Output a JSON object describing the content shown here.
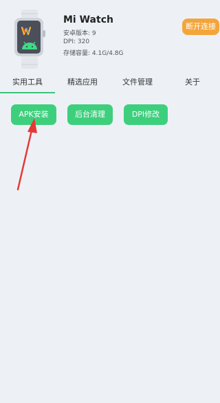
{
  "device": {
    "name": "Mi Watch",
    "version": "安卓版本: 9",
    "dpi": "DPI: 320",
    "storage": "存储容量: 4.1G/4.8G",
    "disconnect_label": "断开连接"
  },
  "tabs": [
    {
      "label": "实用工具",
      "active": true
    },
    {
      "label": "精选应用",
      "active": false
    },
    {
      "label": "文件管理",
      "active": false
    },
    {
      "label": "关于",
      "active": false
    }
  ],
  "tools": [
    {
      "label": "APK安装"
    },
    {
      "label": "后台清理"
    },
    {
      "label": "DPI修改"
    }
  ],
  "colors": {
    "background": "#edf1f6",
    "accent_green": "#3ecf7d",
    "orange": "#f4a53a",
    "annotation_red": "#e53935"
  },
  "icons": {
    "device": "watch-android-icon",
    "annotation": "red-arrow-annotation"
  }
}
